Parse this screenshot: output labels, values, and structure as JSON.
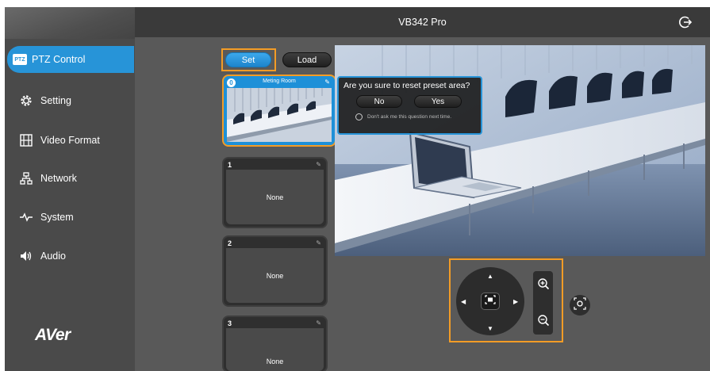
{
  "header": {
    "title": "VB342 Pro",
    "logout_icon": "logout-icon"
  },
  "sidebar": {
    "items": [
      {
        "label": "PTZ Control",
        "icon": "ptz-icon",
        "badge": "PTZ",
        "active": true
      },
      {
        "label": "Setting",
        "icon": "gear-icon"
      },
      {
        "label": "Video Format",
        "icon": "film-icon"
      },
      {
        "label": "Network",
        "icon": "network-icon"
      },
      {
        "label": "System",
        "icon": "pulse-icon"
      },
      {
        "label": "Audio",
        "icon": "speaker-icon"
      }
    ],
    "logo": "AVer"
  },
  "preset_controls": {
    "set_label": "Set",
    "load_label": "Load"
  },
  "presets": [
    {
      "number": "0",
      "name": "Meting Room",
      "selected": true
    },
    {
      "number": "1",
      "name": "None"
    },
    {
      "number": "2",
      "name": "None"
    },
    {
      "number": "3",
      "name": "None"
    }
  ],
  "dialog": {
    "question": "Are you sure to reset preset area?",
    "no_label": "No",
    "yes_label": "Yes",
    "checkbox_label": "Don't ask me this question next time."
  },
  "colors": {
    "accent": "#2794d8",
    "highlight": "#f39c26",
    "background": "#595959",
    "sidebar": "#4a4a4a",
    "topbar": "#3a3a3a"
  }
}
